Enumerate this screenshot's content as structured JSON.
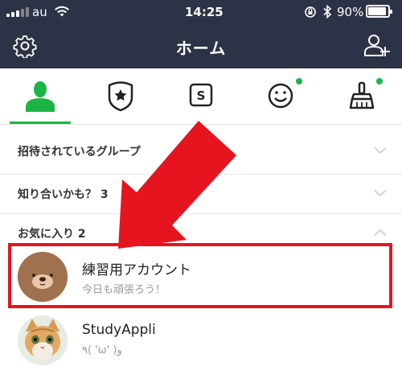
{
  "status_bar": {
    "carrier": "au",
    "time": "14:25",
    "battery": "90%"
  },
  "nav": {
    "title": "ホーム",
    "left_icon": "settings-gear-icon",
    "right_icon": "add-friend-icon"
  },
  "tabs": [
    {
      "icon": "friends-icon",
      "active": true
    },
    {
      "icon": "official-account-icon",
      "active": false
    },
    {
      "icon": "sticker-shop-icon",
      "active": false
    },
    {
      "icon": "emoji-icon",
      "active": false,
      "badge": true
    },
    {
      "icon": "theme-brush-icon",
      "active": false,
      "badge": true
    }
  ],
  "sections": {
    "invited_groups": "招待されているグループ",
    "maybe_known": "知り合いかも？ 3",
    "favorites": "お気に入り 2"
  },
  "friends": [
    {
      "name": "練習用アカウント",
      "status": "今日も頑張ろう！"
    },
    {
      "name": "StudyAppli",
      "status": "٩( 'ω' )و"
    }
  ],
  "colors": {
    "header_bg": "#2c3346",
    "accent_green": "#1db446",
    "highlight_red": "#e6141f"
  }
}
